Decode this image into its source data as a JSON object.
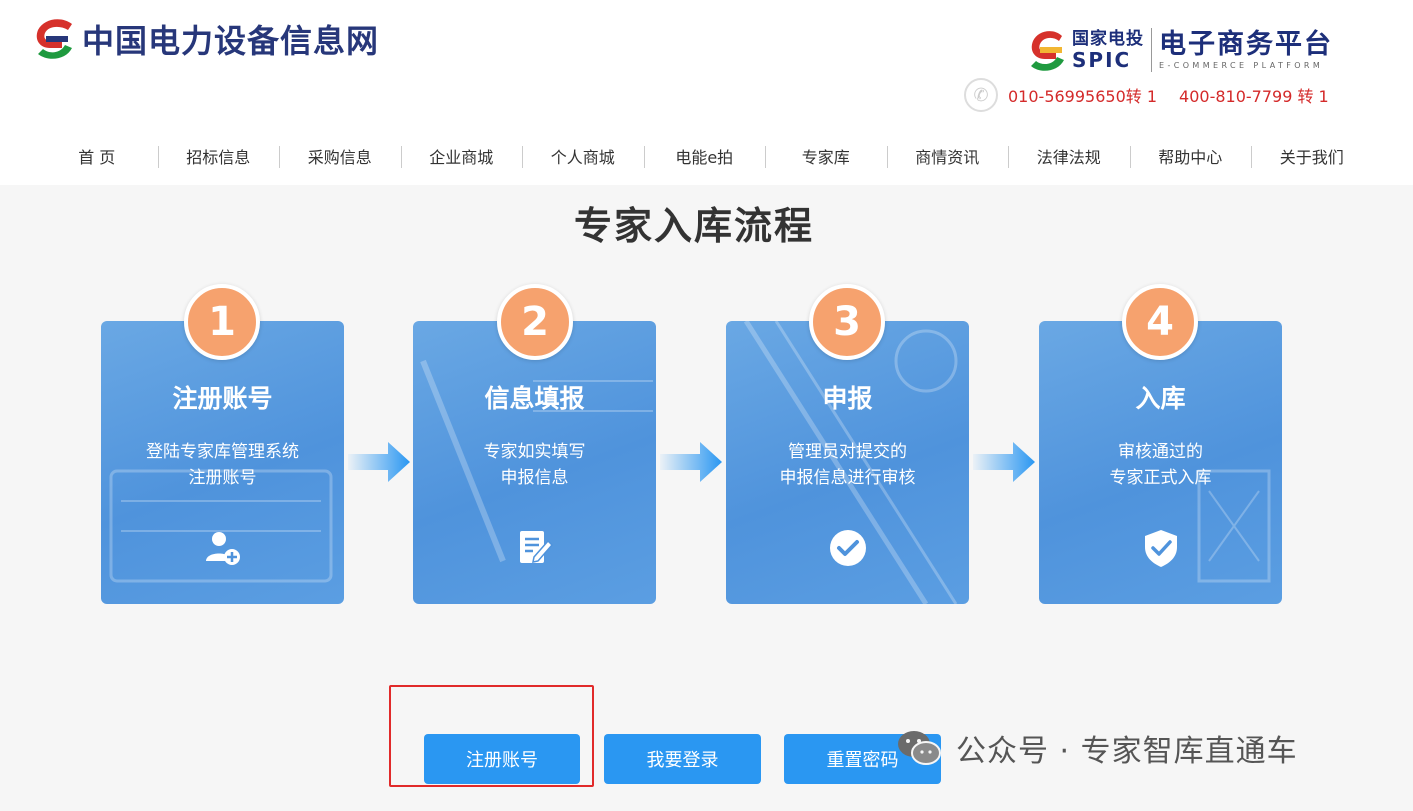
{
  "header": {
    "site_title": "中国电力设备信息网",
    "partner_cn": "国家电投",
    "partner_en": "SPIC",
    "platform_cn": "电子商务平台",
    "platform_en": "E-COMMERCE PLATFORM",
    "phone1": "010-56995650转 1",
    "phone2": "400-810-7799 转 1"
  },
  "nav": {
    "items": [
      "首 页",
      "招标信息",
      "采购信息",
      "企业商城",
      "个人商城",
      "电能e拍",
      "专家库",
      "商情资讯",
      "法律法规",
      "帮助中心",
      "关于我们"
    ]
  },
  "main": {
    "title": "专家入库流程",
    "steps": [
      {
        "number": "1",
        "title": "注册账号",
        "desc_line1": "登陆专家库管理系统",
        "desc_line2": "注册账号",
        "icon": "user-add-icon"
      },
      {
        "number": "2",
        "title": "信息填报",
        "desc_line1": "专家如实填写",
        "desc_line2": "申报信息",
        "icon": "edit-document-icon"
      },
      {
        "number": "3",
        "title": "申报",
        "desc_line1": "管理员对提交的",
        "desc_line2": "申报信息进行审核",
        "icon": "check-circle-icon"
      },
      {
        "number": "4",
        "title": "入库",
        "desc_line1": "审核通过的",
        "desc_line2": "专家正式入库",
        "icon": "shield-check-icon"
      }
    ],
    "buttons": {
      "register": "注册账号",
      "login": "我要登录",
      "reset": "重置密码"
    }
  },
  "watermark": {
    "text": "公众号 · 专家智库直通车"
  },
  "colors": {
    "card_blue": "#4f93dc",
    "badge_orange": "#f6a26e",
    "button_blue": "#2a97f2",
    "highlight_red": "#e12a2a",
    "title_navy": "#27377a"
  }
}
